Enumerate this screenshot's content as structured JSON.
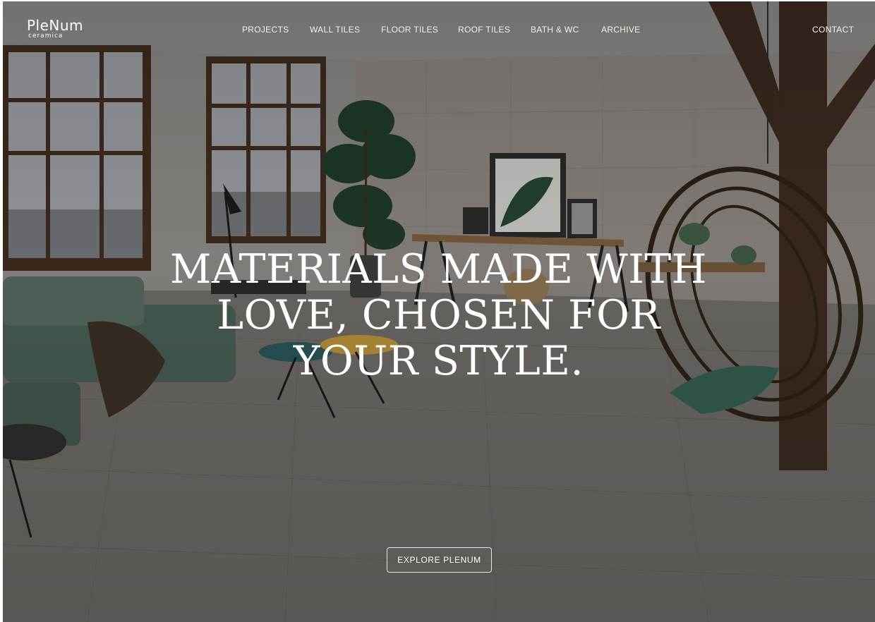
{
  "brand": {
    "name": "PleNum",
    "sub": "ceramica"
  },
  "nav": {
    "items": [
      {
        "label": "PROJECTS"
      },
      {
        "label": "WALL TILES"
      },
      {
        "label": "FLOOR TILES"
      },
      {
        "label": "ROOF TILES"
      },
      {
        "label": "BATH & WC"
      },
      {
        "label": "ARCHIVE"
      }
    ],
    "contact": "CONTACT"
  },
  "hero": {
    "lines": [
      "MATERIALS MADE WITH",
      "LOVE, CHOSEN FOR",
      "YOUR STYLE."
    ],
    "cta": "EXPLORE PLENUM"
  },
  "colors": {
    "text": "#ffffff",
    "floor": "#6f6c68",
    "wall": "#8a8580",
    "beam": "#3a2a22",
    "sofa": "#4e6558"
  }
}
